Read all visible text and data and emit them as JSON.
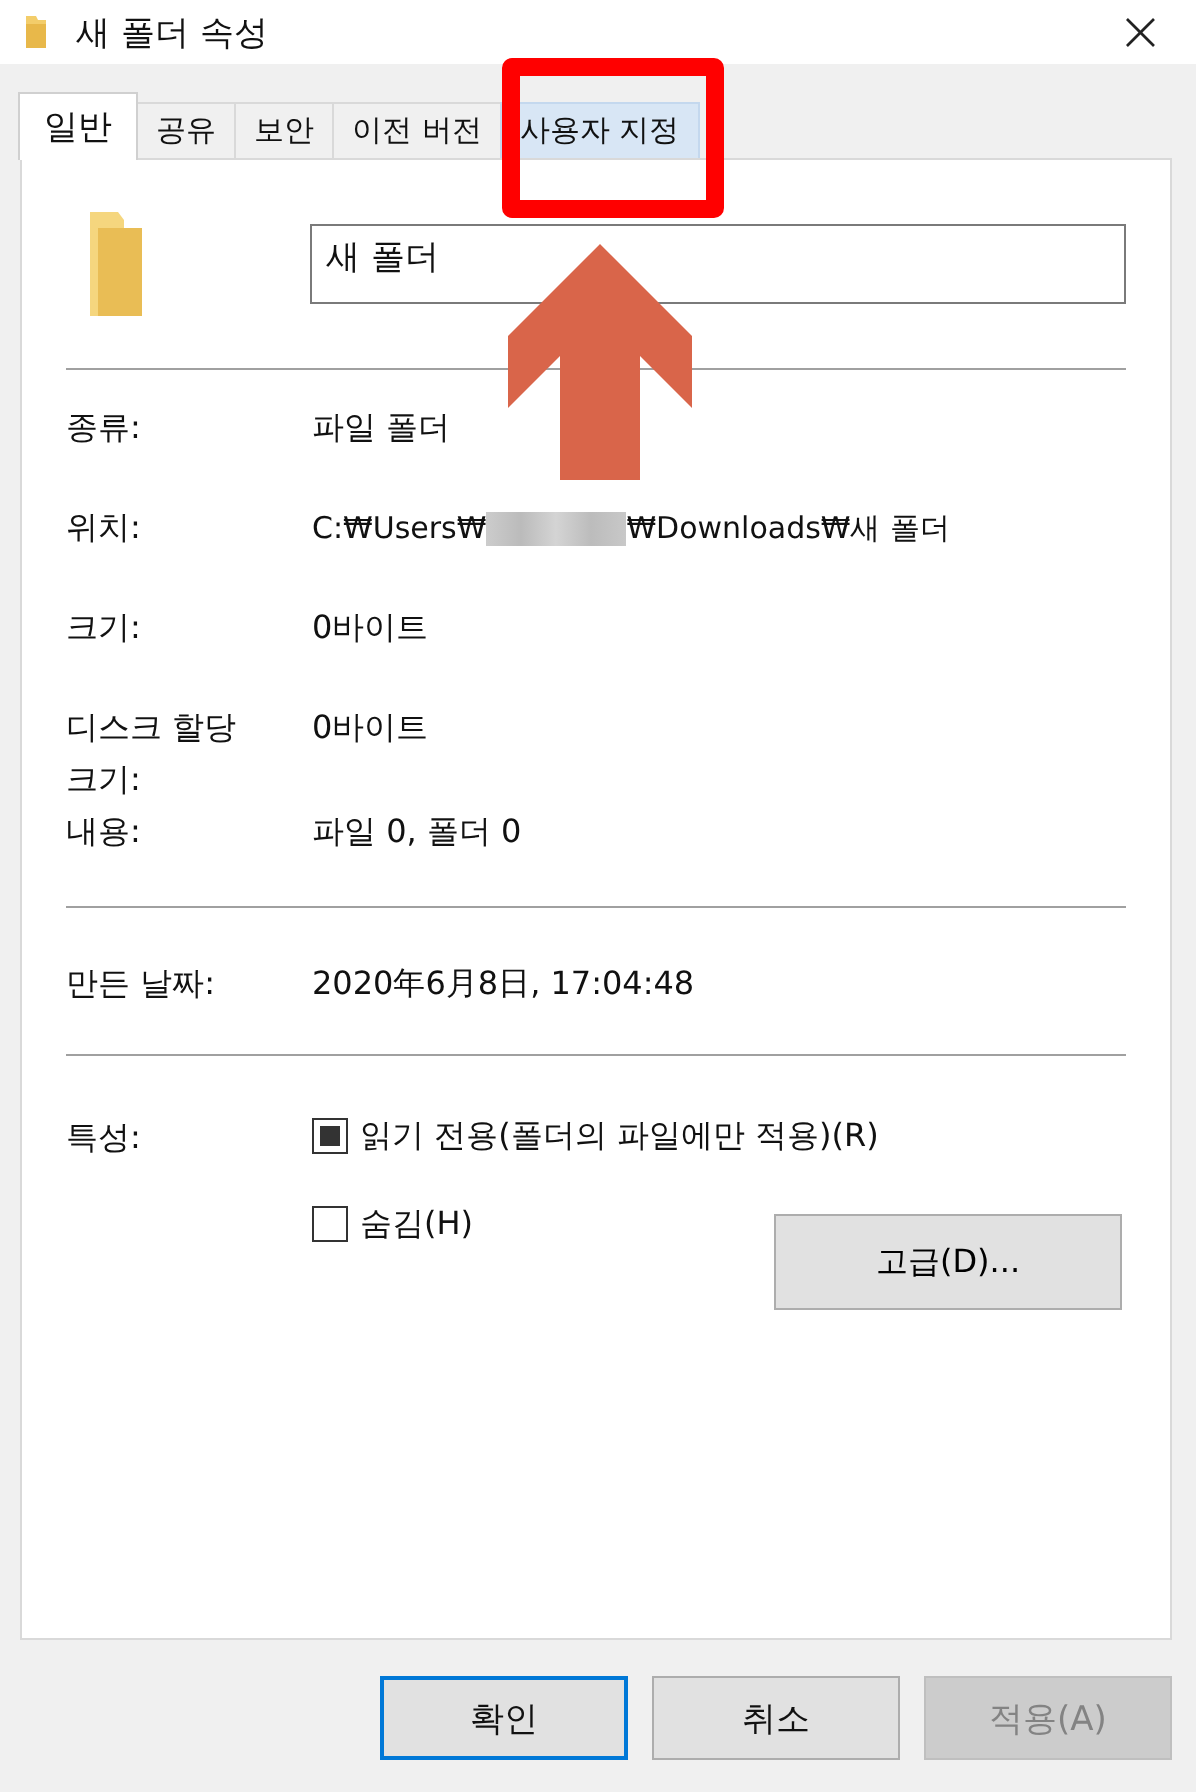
{
  "window": {
    "title": "새 폴더 속성",
    "close": "×"
  },
  "tabs": [
    {
      "label": "일반",
      "selected": true,
      "hovered": false
    },
    {
      "label": "공유",
      "selected": false,
      "hovered": false
    },
    {
      "label": "보안",
      "selected": false,
      "hovered": false
    },
    {
      "label": "이전 버전",
      "selected": false,
      "hovered": false
    },
    {
      "label": "사용자 지정",
      "selected": false,
      "hovered": true,
      "highlighted": true,
      "arrow": true
    }
  ],
  "name_field": {
    "value": "새 폴더"
  },
  "details": [
    {
      "label": "종류:",
      "value": "파일 폴더"
    },
    {
      "label": "위치:",
      "value": "C:₩Users₩",
      "redacted": true,
      "value_end": "₩Downloads₩새 폴더"
    },
    {
      "label": "크기:",
      "value": "0바이트"
    },
    {
      "label": "디스크 할당 크기:",
      "value": "0바이트"
    },
    {
      "label": "내용:",
      "value": "파일 0, 폴더 0"
    }
  ],
  "created": {
    "label": "만든 날짜:",
    "value": "2020年6月8日, 17:04:48"
  },
  "attributes": {
    "label": "특성:",
    "options": [
      {
        "label": "읽기 전용(폴더의 파일에만 적용)(R)",
        "checked": false,
        "indeterminate": true
      },
      {
        "label": "숨김(H)",
        "checked": false,
        "indeterminate": false
      }
    ],
    "advanced": "고급(D)..."
  },
  "buttons": [
    {
      "label": "확인",
      "default": true,
      "disabled": false
    },
    {
      "label": "취소",
      "default": false,
      "disabled": false
    },
    {
      "label": "적용(A)",
      "default": false,
      "disabled": true
    }
  ]
}
